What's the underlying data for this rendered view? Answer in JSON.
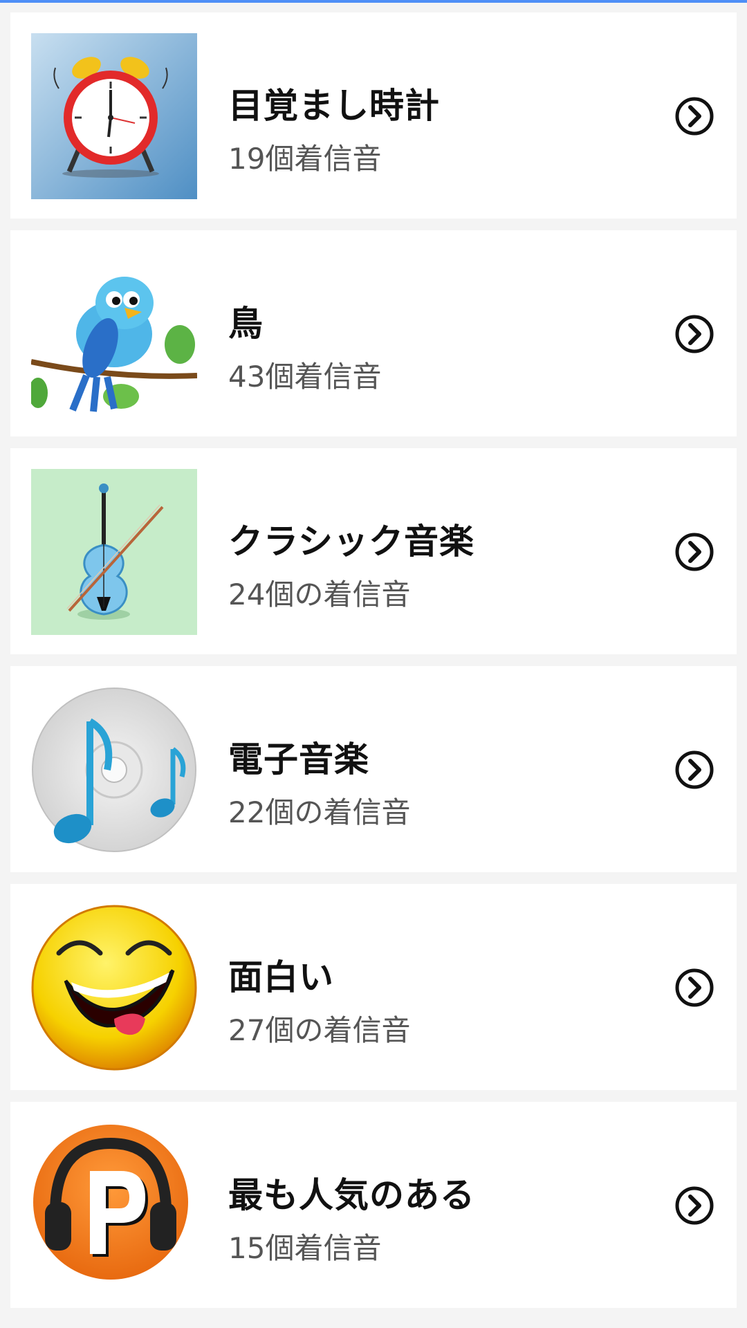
{
  "categories": [
    {
      "title": "目覚まし時計",
      "count_label": "19個着信音",
      "icon": "alarm-clock-icon"
    },
    {
      "title": "鳥",
      "count_label": "43個着信音",
      "icon": "bird-icon"
    },
    {
      "title": "クラシック音楽",
      "count_label": "24個の着信音",
      "icon": "violin-icon"
    },
    {
      "title": "電子音楽",
      "count_label": "22個の着信音",
      "icon": "music-disc-icon"
    },
    {
      "title": "面白い",
      "count_label": "27個の着信音",
      "icon": "laughing-face-icon"
    },
    {
      "title": "最も人気のある",
      "count_label": "15個着信音",
      "icon": "headphones-p-icon"
    }
  ],
  "colors": {
    "accent": "#4f8ff7",
    "card_bg": "#ffffff",
    "page_bg": "#f4f4f4",
    "title_text": "#111111",
    "sub_text": "#555555"
  }
}
